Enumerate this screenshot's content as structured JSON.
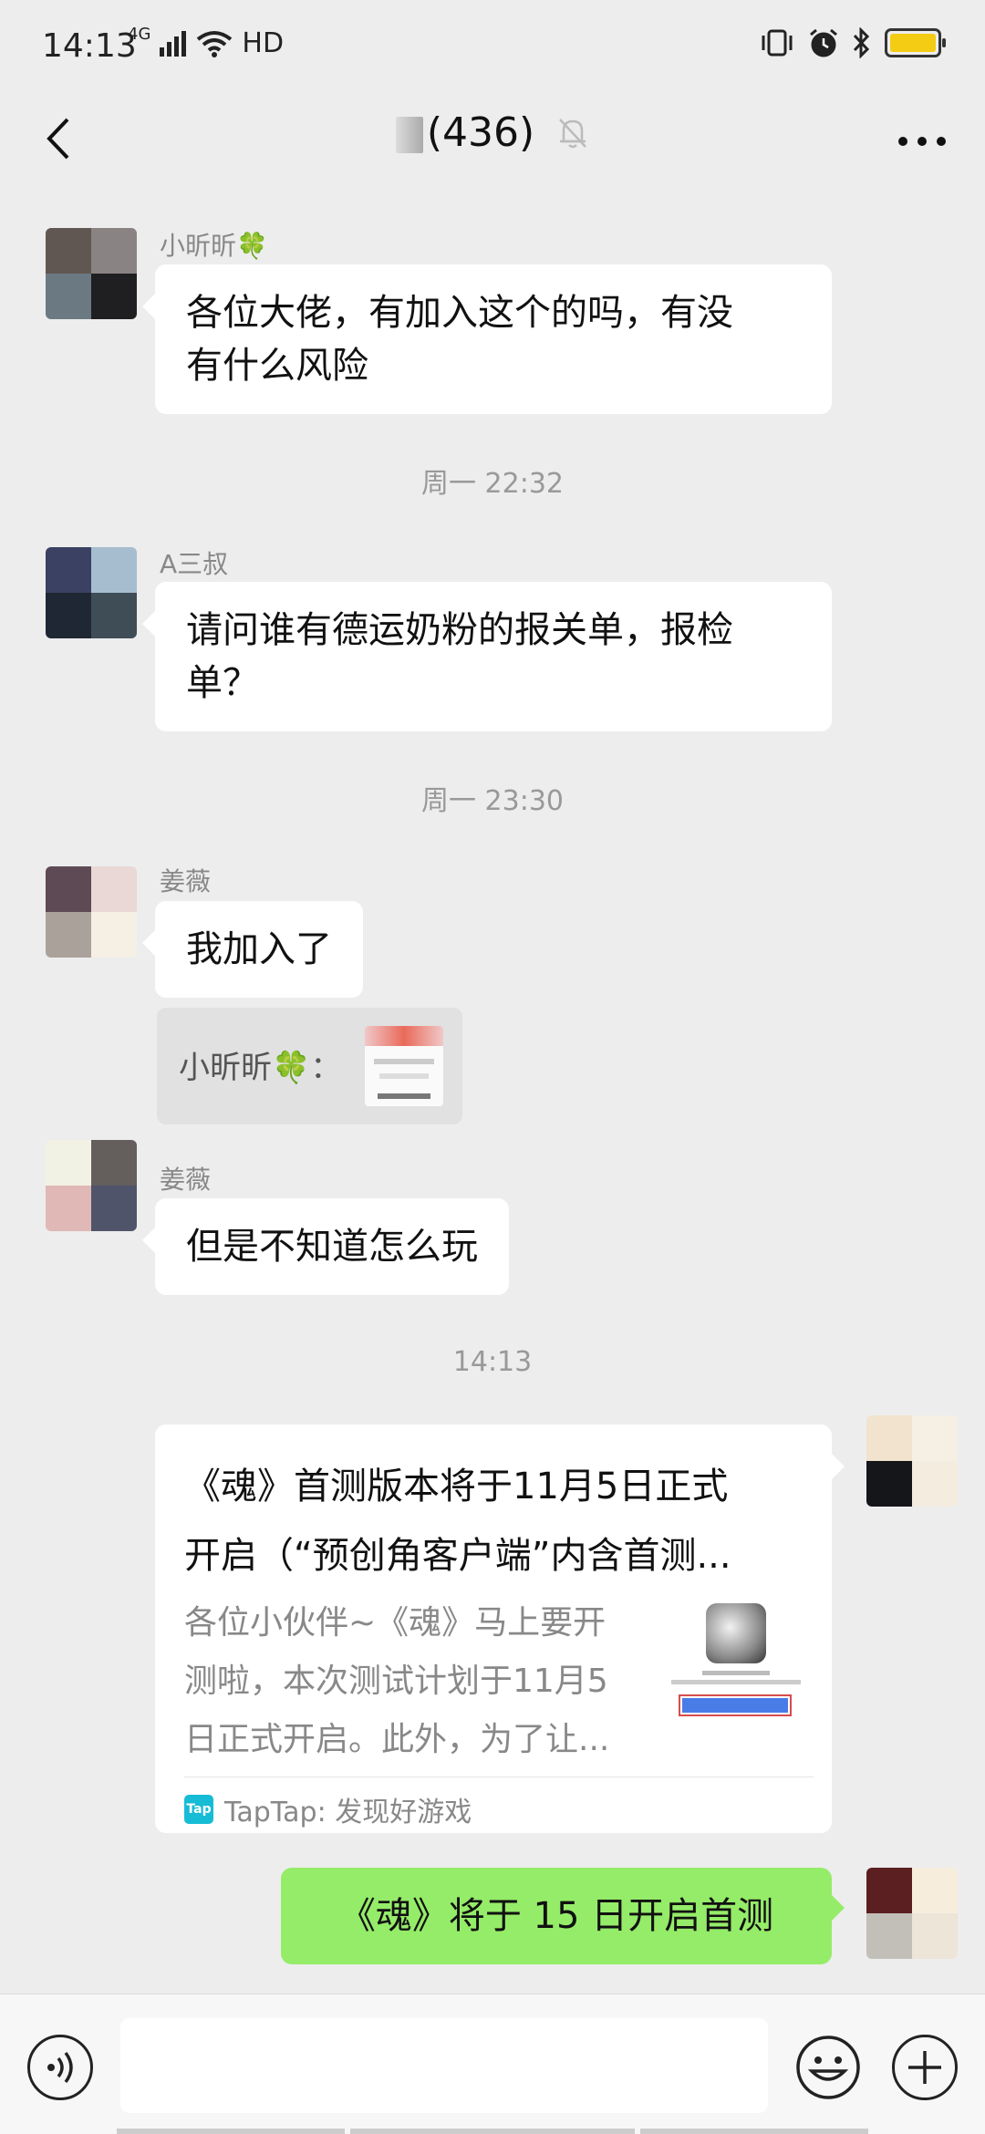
{
  "status_bar": {
    "time": "14:13",
    "network": "4G",
    "hd": "HD"
  },
  "header": {
    "title": "(436)"
  },
  "messages": [
    {
      "sender": "小昕昕🍀",
      "text": "各位大佬，有加入这个的吗，有没有什么风险"
    },
    {
      "divider": "周一 22:32"
    },
    {
      "sender": "A三叔",
      "text": "请问谁有德运奶粉的报关单，报检单？"
    },
    {
      "divider": "周一 23:30"
    },
    {
      "sender": "姜薇",
      "text": "我加入了"
    },
    {
      "quote": "小昕昕🍀："
    },
    {
      "sender": "姜薇",
      "text": "但是不知道怎么玩"
    },
    {
      "divider": "14:13"
    }
  ],
  "m": {
    "m0_sender": "小昕昕🍀",
    "m0_line1": "各位大佬，有加入这个的吗，有没",
    "m0_line2": "有什么风险",
    "d1": "周一 22:32",
    "m1_sender": "A三叔",
    "m1_line1": "请问谁有德运奶粉的报关单，报检",
    "m1_line2": "单？",
    "d2": "周一 23:30",
    "m2_sender": "姜薇",
    "m2_text": "我加入了",
    "quote_text": "小昕昕🍀：",
    "m3_sender": "姜薇",
    "m3_text": "但是不知道怎么玩",
    "d3": "14:13"
  },
  "link_card": {
    "title_line1": "《魂》首测版本将于11月5日正式",
    "title_line2": "开启（“预创角客户端”内含首测...",
    "desc_line1": "各位小伙伴~《魂》马上要开",
    "desc_line2": "测啦，本次测试计划于11月5",
    "desc_line3": "日正式开启。此外，为了让...",
    "source_icon": "Tap",
    "source": "TapTap: 发现好游戏"
  },
  "my_message": {
    "text": "《魂》将于 15 日开启首测"
  },
  "colors": {
    "background": "#ededed",
    "bubble_self": "#95ec69",
    "bubble_other": "#ffffff",
    "battery": "#f4cc14",
    "taptap": "#16bcd5"
  }
}
